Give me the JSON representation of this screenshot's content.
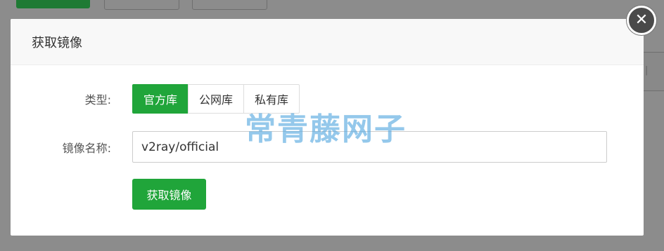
{
  "modal": {
    "title": "获取镜像",
    "close_icon": "close-icon"
  },
  "form": {
    "type_label": "类型:",
    "type_options": [
      "官方库",
      "公网库",
      "私有库"
    ],
    "selected_type": "官方库",
    "name_label": "镜像名称:",
    "name_value": "v2ray/official",
    "submit_label": "获取镜像"
  },
  "watermark": "常青藤网子",
  "colors": {
    "accent": "#20a53a",
    "overlay": "#8c8c8c",
    "watermark": "#5aaae1"
  }
}
